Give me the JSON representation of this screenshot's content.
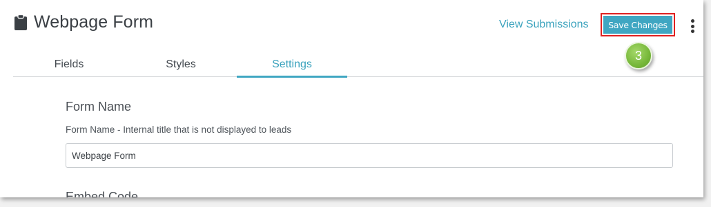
{
  "header": {
    "title": "Webpage Form",
    "icon": "clipboard-icon",
    "view_submissions_label": "View Submissions",
    "save_label": "Save Changes",
    "more_icon": "kebab-menu-icon"
  },
  "callout": {
    "step_number": "3",
    "highlight_color": "#e02020",
    "badge_color": "#77b83a"
  },
  "tabs": [
    {
      "label": "Fields",
      "active": false
    },
    {
      "label": "Styles",
      "active": false
    },
    {
      "label": "Settings",
      "active": true
    }
  ],
  "settings": {
    "form_name_heading": "Form Name",
    "form_name_label": "Form Name - Internal title that is not displayed to leads",
    "form_name_value": "Webpage Form",
    "embed_code_heading": "Embed Code"
  },
  "colors": {
    "accent": "#3fa6c2",
    "link": "#3aa2bd",
    "text": "#3a3f44"
  }
}
